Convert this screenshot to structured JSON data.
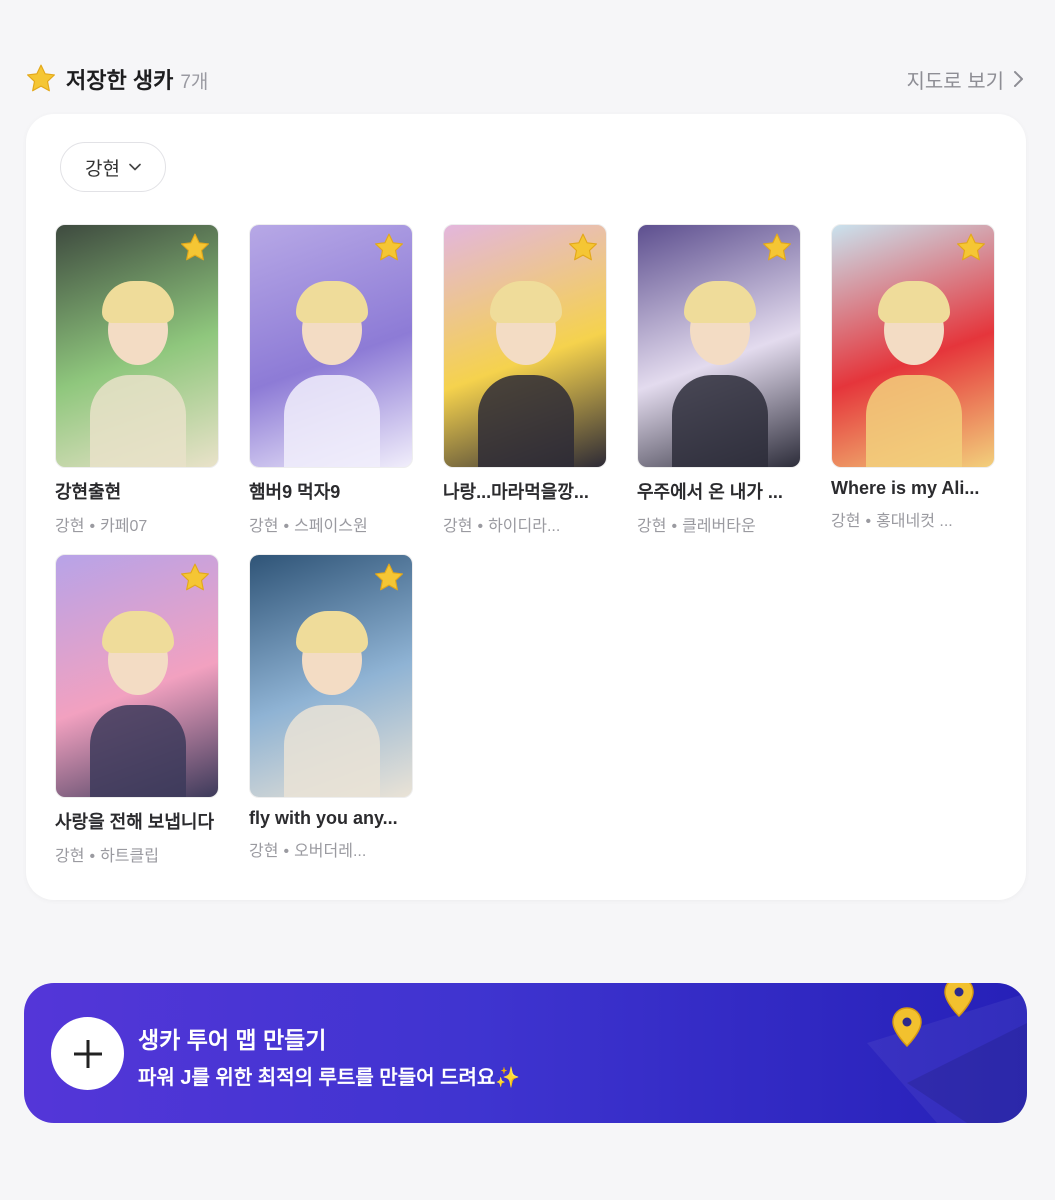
{
  "header": {
    "title": "저장한 생카",
    "count": "7개",
    "map_link": "지도로 보기"
  },
  "filter": {
    "selected": "강현"
  },
  "cards": [
    {
      "title": "강현출현",
      "artist": "강현",
      "place": "카페07",
      "palette": [
        "#3e4a3f",
        "#8fc77d",
        "#e9e2c9"
      ]
    },
    {
      "title": "햄버9 먹자9",
      "artist": "강현",
      "place": "스페이스원",
      "palette": [
        "#b7a8e6",
        "#8d7bd6",
        "#f1eefb"
      ]
    },
    {
      "title": "나랑...마라먹을깡...",
      "artist": "강현",
      "place": "하이디라...",
      "palette": [
        "#e3b6dd",
        "#f5d24d",
        "#2d2a36"
      ]
    },
    {
      "title": "우주에서 온 내가 ...",
      "artist": "강현",
      "place": "클레버타운",
      "palette": [
        "#5d4f8f",
        "#e3dbee",
        "#2d2d3a"
      ]
    },
    {
      "title": "Where is my Ali...",
      "artist": "강현",
      "place": "홍대네컷 ...",
      "palette": [
        "#c9e2ee",
        "#e5353b",
        "#f2d07c"
      ]
    },
    {
      "title": "사랑을 전해 보냅니다",
      "artist": "강현",
      "place": "하트클립",
      "palette": [
        "#b7a3e8",
        "#f2a1c0",
        "#3c3a5a"
      ]
    },
    {
      "title": "fly with you any...",
      "artist": "강현",
      "place": "오버더레...",
      "palette": [
        "#2f5477",
        "#8fb3d4",
        "#eae3d6"
      ]
    }
  ],
  "banner": {
    "title": "생카 투어 맵 만들기",
    "subtitle": "파워 J를 위한 최적의 루트를 만들어 드려요",
    "sparkle": "✨"
  },
  "colors": {
    "accent_gradient_start": "#5436d8",
    "accent_gradient_end": "#2620b8",
    "star": "#f5c634",
    "pin": "#f2c12e"
  }
}
